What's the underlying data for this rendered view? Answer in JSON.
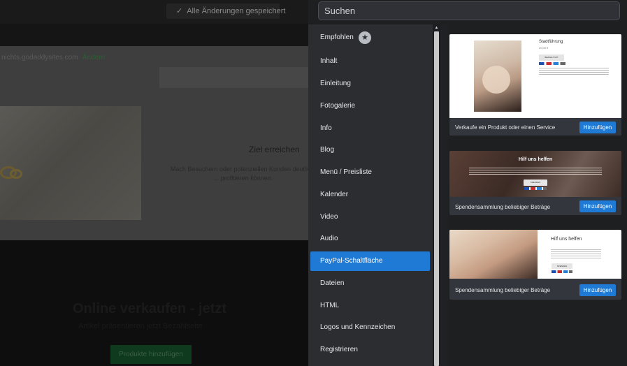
{
  "editor": {
    "saved_status": "Alle Änderungen gespeichert",
    "domain": "nichts.godaddysites.com",
    "change_link": "Ändern",
    "goal_title": "Ziel erreichen",
    "goal_text": "Mach Besuchern oder potenziellen Kunden deutlich, ... profitieren können.",
    "sell_title": "Online verkaufen - jetzt",
    "sell_subtitle": "Artikel präsentieren jetzt Bezahlseite",
    "add_products_button": "Produkte hinzufügen"
  },
  "panel": {
    "search_placeholder": "Suchen",
    "categories": [
      {
        "label": "Empfohlen",
        "active": false
      },
      {
        "label": "Inhalt",
        "active": false
      },
      {
        "label": "Einleitung",
        "active": false
      },
      {
        "label": "Fotogalerie",
        "active": false
      },
      {
        "label": "Info",
        "active": false
      },
      {
        "label": "Blog",
        "active": false
      },
      {
        "label": "Menü / Preisliste",
        "active": false
      },
      {
        "label": "Kalender",
        "active": false
      },
      {
        "label": "Video",
        "active": false
      },
      {
        "label": "Audio",
        "active": false
      },
      {
        "label": "PayPal-Schaltfläche",
        "active": true
      },
      {
        "label": "Dateien",
        "active": false
      },
      {
        "label": "HTML",
        "active": false
      },
      {
        "label": "Logos und Kennzeichen",
        "active": false
      },
      {
        "label": "Registrieren",
        "active": false
      }
    ],
    "tiles": [
      {
        "caption": "Verkaufe ein Produkt oder einen Service",
        "button": "Hinzufügen",
        "preview": {
          "title": "Stadtführung",
          "price": "20,00 €",
          "paypal": "BEZAHLT MIT"
        }
      },
      {
        "caption": "Spendensammlung beliebiger Beträge",
        "button": "Hinzufügen",
        "preview": {
          "title": "Hilf uns helfen",
          "paypal": "SPENDEN"
        }
      },
      {
        "caption": "Spendensammlung beliebiger Beträge",
        "button": "Hinzufügen",
        "preview": {
          "title": "Hilf uns helfen",
          "paypal": "SPENDEN"
        }
      }
    ]
  },
  "colors": {
    "panel_bg": "#1e1f21",
    "category_bg": "#2b2d31",
    "accent": "#1f7ad6",
    "tile_bg": "#33363c"
  }
}
